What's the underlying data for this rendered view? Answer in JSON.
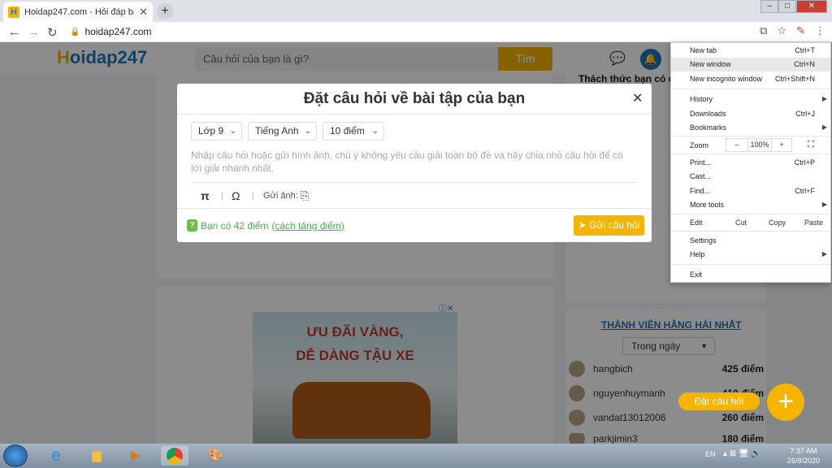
{
  "browser": {
    "tab_title": "Hoidap247.com - Hỏi đáp bài tập",
    "url": "hoidap247.com",
    "favicon": "H"
  },
  "site": {
    "logo_main": "oidap247",
    "logo_first": "H",
    "search_placeholder": "Câu hỏi của bạn là gì?",
    "search_button": "Tìm",
    "challenge_title": "Thách thức bạn có đ",
    "members_title": "THÀNH VIÊN HĂNG HÁI NHẤT",
    "period_select": "Trong ngày",
    "members": [
      {
        "name": "hangbich",
        "points": "425 điểm"
      },
      {
        "name": "nguyenhuymanh",
        "points": "410 điểm"
      },
      {
        "name": "vandat13012006",
        "points": "260 điểm"
      },
      {
        "name": "parkjimin3",
        "points": "180 điểm"
      }
    ],
    "fab_label": "Đặt câu hỏi",
    "ad_line1": "ƯU ĐÃI VÀNG,",
    "ad_line2": "DỄ DÀNG TẬU XE"
  },
  "modal": {
    "title": "Đặt câu hỏi về bài tập của bạn",
    "grade": "Lớp 9",
    "subject": "Tiếng Anh",
    "points_select": "10 điểm",
    "placeholder": "Nhập câu hỏi hoặc gửi hình ảnh, chú ý không yêu cầu giải toàn bộ đề và hãy chia nhỏ câu hỏi để có lời giải nhanh nhất.",
    "send_image_label": "Gửi ảnh:",
    "points_text": "Bạn có 42 điểm",
    "points_link": "(cách tăng điểm)",
    "submit": "Gửi câu hỏi"
  },
  "chrome_menu": {
    "new_tab": "New tab",
    "new_tab_sc": "Ctrl+T",
    "new_window": "New window",
    "new_window_sc": "Ctrl+N",
    "new_incognito": "New incognito window",
    "new_incognito_sc": "Ctrl+Shift+N",
    "history": "History",
    "downloads": "Downloads",
    "downloads_sc": "Ctrl+J",
    "bookmarks": "Bookmarks",
    "zoom": "Zoom",
    "zoom_minus": "–",
    "zoom_value": "100%",
    "zoom_plus": "+",
    "print": "Print...",
    "print_sc": "Ctrl+P",
    "cast": "Cast...",
    "find": "Find...",
    "find_sc": "Ctrl+F",
    "more_tools": "More tools",
    "edit": "Edit",
    "cut": "Cut",
    "copy": "Copy",
    "paste": "Paste",
    "settings": "Settings",
    "help": "Help",
    "exit": "Exit"
  },
  "taskbar": {
    "lang": "EN",
    "time": "7:37 AM",
    "date": "26/8/2020"
  },
  "colors": {
    "accent": "#f4b400",
    "brand": "#1e73be",
    "green": "#4caf50"
  }
}
